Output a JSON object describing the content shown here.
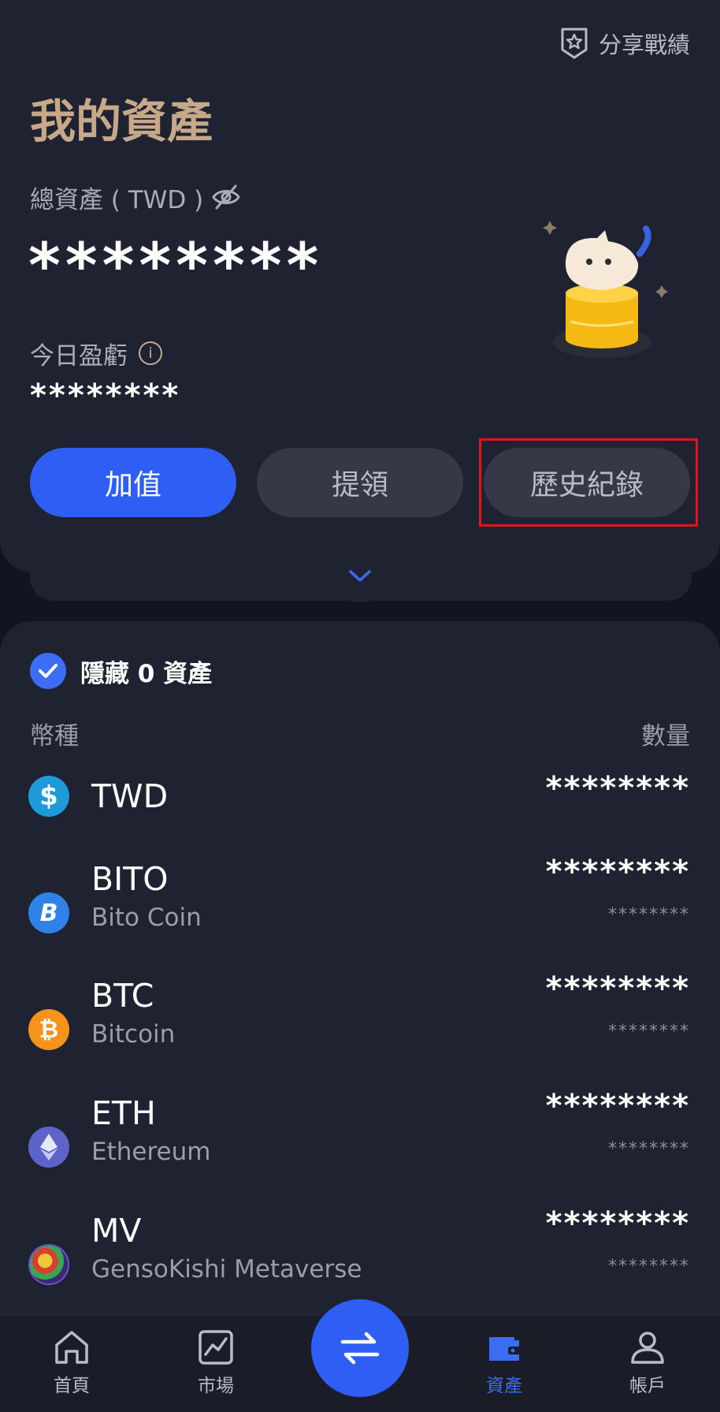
{
  "header": {
    "share_label": "分享戰績",
    "title": "我的資產",
    "total_label": "總資產 ( TWD )",
    "total_value": "********",
    "pnl_label": "今日盈虧",
    "pnl_info": "i",
    "pnl_value": "********"
  },
  "actions": {
    "deposit": "加值",
    "withdraw": "提領",
    "history": "歷史紀錄"
  },
  "assets": {
    "hide_label": "隱藏 0 資產",
    "col_currency": "幣種",
    "col_amount": "數量",
    "items": [
      {
        "symbol": "TWD",
        "name": "",
        "icon": "dollar-icon",
        "color": "#1d9bd8",
        "amount": "********",
        "sub": ""
      },
      {
        "symbol": "BITO",
        "name": "Bito Coin",
        "icon": "bito-icon",
        "color": "#2f82e8",
        "amount": "********",
        "sub": "********"
      },
      {
        "symbol": "BTC",
        "name": "Bitcoin",
        "icon": "bitcoin-icon",
        "color": "#f7931a",
        "amount": "********",
        "sub": "********"
      },
      {
        "symbol": "ETH",
        "name": "Ethereum",
        "icon": "ethereum-icon",
        "color": "#5d63c9",
        "amount": "********",
        "sub": "********"
      },
      {
        "symbol": "MV",
        "name": "GensoKishi Metaverse",
        "icon": "mv-icon",
        "color": "#3b2a6e",
        "amount": "********",
        "sub": "********"
      }
    ]
  },
  "nav": {
    "home": "首頁",
    "market": "市場",
    "assets": "資產",
    "account": "帳戶"
  },
  "colors": {
    "accent": "#2f5ef4",
    "title_gold": "#c7a98a",
    "highlight": "#e0151b"
  }
}
